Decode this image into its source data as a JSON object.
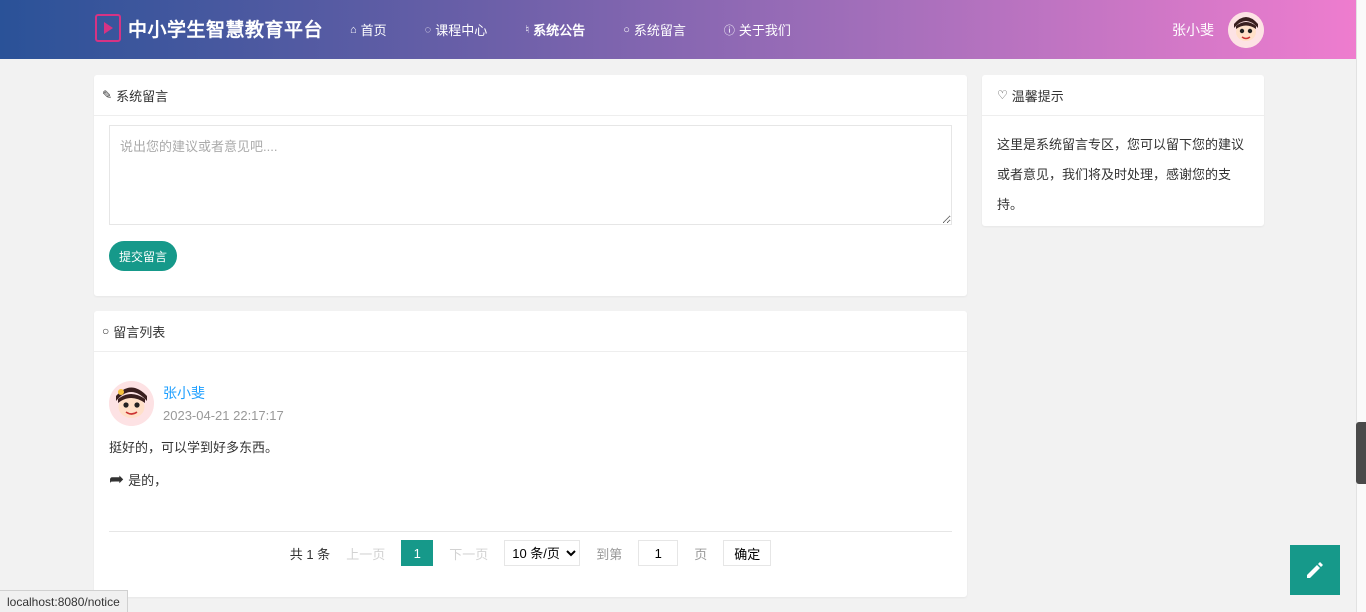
{
  "header": {
    "brand": "中小学生智慧教育平台",
    "nav": [
      {
        "icon": "home-icon",
        "label": "首页"
      },
      {
        "icon": "leaf-icon",
        "label": "课程中心"
      },
      {
        "icon": "bell-icon",
        "label": "系统公告"
      },
      {
        "icon": "comments-icon",
        "label": "系统留言"
      },
      {
        "icon": "info-icon",
        "label": "关于我们"
      }
    ],
    "user_name": "张小斐"
  },
  "compose": {
    "title": "系统留言",
    "placeholder": "说出您的建议或者意见吧....",
    "submit_label": "提交留言"
  },
  "tip": {
    "title": "温馨提示",
    "text": "这里是系统留言专区，您可以留下您的建议或者意见，我们将及时处理，感谢您的支持。"
  },
  "list": {
    "title": "留言列表",
    "messages": [
      {
        "user": "张小斐",
        "time": "2023-04-21 22:17:17",
        "content": "挺好的，可以学到好多东西。",
        "reply": "是的，"
      }
    ]
  },
  "pager": {
    "total": "共 1 条",
    "prev": "上一页",
    "current": "1",
    "next": "下一页",
    "page_size": "10 条/页",
    "goto": "到第",
    "goto_value": "1",
    "page_unit": "页",
    "confirm": "确定"
  },
  "status_url": "localhost:8080/notice",
  "colors": {
    "accent": "#16998a",
    "link": "#1e9fff",
    "brand_logo": "#d63384"
  }
}
